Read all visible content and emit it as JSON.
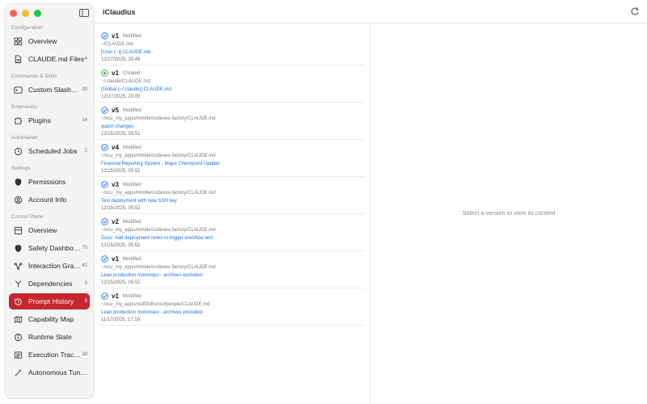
{
  "app": {
    "title": "iClaudius"
  },
  "sidebar": {
    "sections": [
      {
        "label": "Configuration",
        "items": [
          {
            "label": "Overview",
            "icon": "grid-icon",
            "count": ""
          },
          {
            "label": "CLAUDE.md Files",
            "icon": "document-icon",
            "count": "4"
          }
        ]
      },
      {
        "label": "Commands & Skills",
        "items": [
          {
            "label": "Custom Slash…",
            "icon": "terminal-icon",
            "count": "20"
          }
        ]
      },
      {
        "label": "Extensions",
        "items": [
          {
            "label": "Plugins",
            "icon": "puzzle-icon",
            "count": "14"
          }
        ]
      },
      {
        "label": "Automation",
        "items": [
          {
            "label": "Scheduled Jobs",
            "icon": "clock-icon",
            "count": "2"
          }
        ]
      },
      {
        "label": "Settings",
        "items": [
          {
            "label": "Permissions",
            "icon": "lock-shield-icon",
            "count": ""
          },
          {
            "label": "Account Info",
            "icon": "person-icon",
            "count": ""
          }
        ]
      },
      {
        "label": "Control Plane",
        "items": [
          {
            "label": "Overview",
            "icon": "dashboard-icon",
            "count": ""
          },
          {
            "label": "Safety Dashbo…",
            "icon": "shield-icon",
            "count": "70"
          },
          {
            "label": "Interaction Gra…",
            "icon": "graph-icon",
            "count": "41"
          },
          {
            "label": "Dependencies",
            "icon": "branch-icon",
            "count": "3"
          },
          {
            "label": "Prompt History",
            "icon": "history-icon",
            "count": "8",
            "active": true
          },
          {
            "label": "Capability Map",
            "icon": "map-icon",
            "count": ""
          },
          {
            "label": "Runtime State",
            "icon": "info-icon",
            "count": ""
          },
          {
            "label": "Execution Trac…",
            "icon": "list-icon",
            "count": "30"
          },
          {
            "label": "Autonomous Tun…",
            "icon": "wand-icon",
            "count": ""
          }
        ]
      }
    ]
  },
  "versions": [
    {
      "version": "v1",
      "kind": "Modified",
      "status": "check",
      "path": "~/CLAUDE.md",
      "message": "[User (~)] CLAUDE.md",
      "date": "12/27/2025, 20:49"
    },
    {
      "version": "v1",
      "kind": "Created",
      "status": "plus",
      "path": "~/.claude/CLAUDE.md",
      "message": "[Global (~/.claude)] CLAUDE.md",
      "date": "12/27/2025, 20:00"
    },
    {
      "version": "v5",
      "kind": "Modified",
      "status": "check",
      "path": "~/xcu_my_apps/nimble/codexes-factory/CLAUDE.md",
      "message": "watch changes",
      "date": "12/15/2025, 05:52"
    },
    {
      "version": "v4",
      "kind": "Modified",
      "status": "check",
      "path": "~/xcu_my_apps/nimble/codexes-factory/CLAUDE.md",
      "message": "Financial Reporting System - Major Checkpoint Update",
      "date": "12/15/2025, 05:52"
    },
    {
      "version": "v3",
      "kind": "Modified",
      "status": "check",
      "path": "~/xcu_my_apps/nimble/codexes-factory/CLAUDE.md",
      "message": "Test deployment with new SSH key",
      "date": "12/15/2025, 05:52"
    },
    {
      "version": "v2",
      "kind": "Modified",
      "status": "check",
      "path": "~/xcu_my_apps/nimble/codexes-factory/CLAUDE.md",
      "message": "Docs: Add deployment notes to trigger workflow test",
      "date": "12/15/2025, 05:52"
    },
    {
      "version": "v1",
      "kind": "Modified",
      "status": "check",
      "path": "~/xcu_my_apps/nimble/codexes-factory/CLAUDE.md",
      "message": "Lean production monorepo - archives excluded",
      "date": "12/15/2025, 05:52"
    },
    {
      "version": "v1",
      "kind": "Modified",
      "status": "check",
      "path": "~/xcu_my_apps/xtuff/trillionsofpeople/CLAUDE.md",
      "message": "Lean production monorepo - archives excluded",
      "date": "11/17/2025, 17:18"
    }
  ],
  "detail": {
    "placeholder": "Select a version to view its content"
  },
  "colors": {
    "accent": "#c4282d",
    "link": "#1a73e8",
    "status_check": "#1a73e8",
    "status_plus": "#28a745"
  }
}
